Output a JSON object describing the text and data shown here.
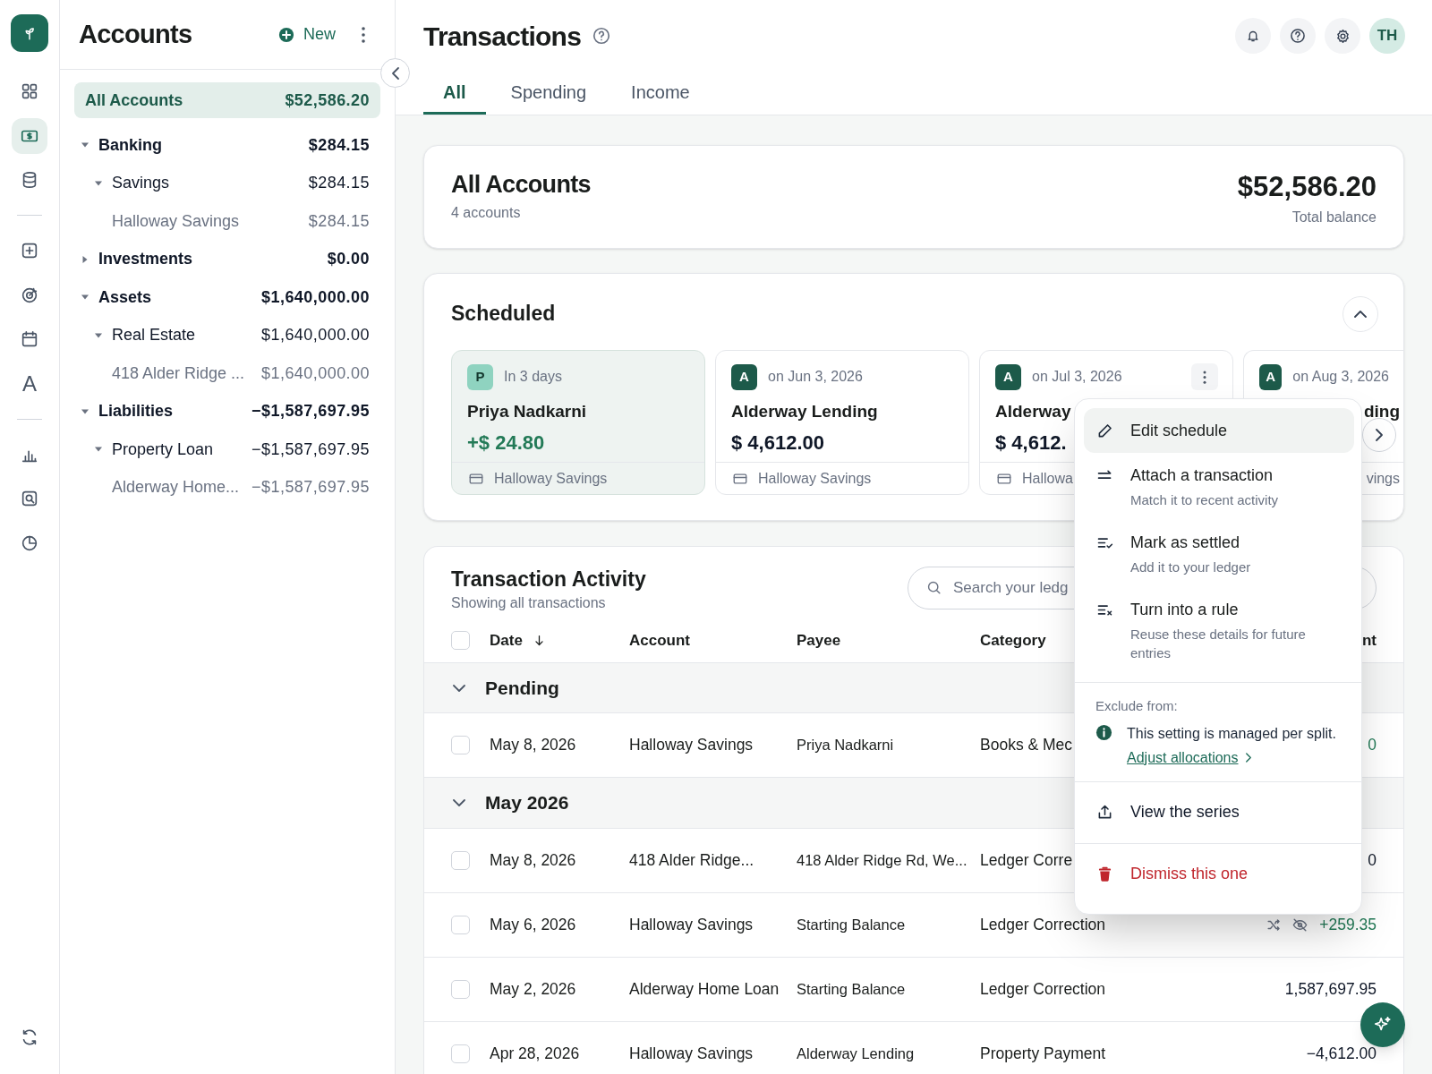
{
  "rail": {
    "groups": [
      {
        "items": [
          {
            "kind": "grid",
            "selected": false
          },
          {
            "kind": "money",
            "selected": true
          },
          {
            "kind": "database",
            "selected": false
          }
        ]
      },
      {
        "items": [
          {
            "kind": "add",
            "selected": false
          },
          {
            "kind": "target",
            "selected": false
          },
          {
            "kind": "calendar",
            "selected": false
          },
          {
            "kind": "letter",
            "label": "A",
            "selected": false
          }
        ]
      },
      {
        "items": [
          {
            "kind": "chart",
            "selected": false
          },
          {
            "kind": "report",
            "selected": false
          },
          {
            "kind": "pie",
            "selected": false
          }
        ]
      }
    ],
    "footer": [
      {
        "kind": "sync",
        "selected": false
      }
    ]
  },
  "accounts": {
    "title": "Accounts",
    "new_button": "New",
    "all_accounts": {
      "label": "All Accounts",
      "amount": "$52,586.20",
      "selected": true
    },
    "tree": [
      {
        "label": "Banking",
        "amount": "$284.15",
        "expanded": true,
        "children": [
          {
            "label": "Savings",
            "amount": "$284.15",
            "expanded": true,
            "children": [
              {
                "label": "Halloway Savings",
                "amount": "$284.15"
              }
            ]
          }
        ]
      },
      {
        "label": "Investments",
        "amount": "$0.00",
        "expanded": false
      },
      {
        "label": "Assets",
        "amount": "$1,640,000.00",
        "expanded": true,
        "children": [
          {
            "label": "Real Estate",
            "amount": "$1,640,000.00",
            "expanded": true,
            "children": [
              {
                "label": "418 Alder Ridge ...",
                "amount": "$1,640,000.00"
              }
            ]
          }
        ]
      },
      {
        "label": "Liabilities",
        "amount": "−$1,587,697.95",
        "expanded": true,
        "children": [
          {
            "label": "Property Loan",
            "amount": "−$1,587,697.95",
            "expanded": true,
            "children": [
              {
                "label": "Alderway Home...",
                "amount": "−$1,587,697.95"
              }
            ]
          }
        ]
      }
    ]
  },
  "header": {
    "title": "Transactions",
    "user_initials": "TH"
  },
  "tabs": [
    {
      "label": "All",
      "selected": true
    },
    {
      "label": "Spending",
      "selected": false
    },
    {
      "label": "Income",
      "selected": false
    }
  ],
  "summary": {
    "title": "All Accounts",
    "subtitle": "4 accounts",
    "amount": "$52,586.20",
    "amount_label": "Total balance"
  },
  "scheduled": {
    "title": "Scheduled",
    "expanded": true,
    "cards": [
      {
        "avatar": "P",
        "color": "#8fd3c0",
        "when": "In 3 days",
        "payee": "Priya Nadkarni",
        "amount": "+$ 24.80",
        "positive": true,
        "account": "Halloway Savings",
        "selected": true,
        "menu_open": false,
        "covered": false
      },
      {
        "avatar": "A",
        "color": "#1d5a4a",
        "when": "on Jun 3, 2026",
        "payee": "Alderway Lending",
        "amount": "$ 4,612.00",
        "positive": false,
        "account": "Halloway Savings",
        "selected": false,
        "menu_open": false,
        "covered": false
      },
      {
        "avatar": "A",
        "color": "#1d5a4a",
        "when": "on Jul 3, 2026",
        "payee": "Alderway",
        "amount": "$ 4,612.",
        "positive": false,
        "account": "Hallowa",
        "selected": false,
        "menu_open": true,
        "covered": false
      },
      {
        "avatar": "A",
        "color": "#1d5a4a",
        "when": "on Aug 3, 2026",
        "payee": "ding",
        "account": "vings",
        "selected": false,
        "menu_open": false,
        "covered": true
      }
    ]
  },
  "activity": {
    "title": "Transaction Activity",
    "subtitle": "Showing all transactions",
    "search": {
      "placeholder": "Search your ledg"
    },
    "all_checked": false,
    "columns": [
      {
        "label": "Date",
        "sorted": true
      },
      {
        "label": "Account",
        "sorted": false
      },
      {
        "label": "Payee",
        "sorted": false
      },
      {
        "label": "Category",
        "sorted": false
      },
      {
        "label": "nt",
        "sorted": false
      }
    ],
    "groups": [
      {
        "label": "Pending",
        "expanded": true,
        "rows": [
          {
            "checked": false,
            "date": "May 8, 2026",
            "account": "Halloway Savings",
            "payee": "Priya Nadkarni",
            "category": "Books & Mec",
            "amount": "0",
            "positive": true,
            "split": false,
            "excluded": false
          }
        ]
      },
      {
        "label": "May 2026",
        "expanded": true,
        "rows": [
          {
            "checked": false,
            "date": "May 8, 2026",
            "account": "418 Alder Ridge...",
            "payee": "418 Alder Ridge Rd, We...",
            "category": "Ledger Corre",
            "amount": "0",
            "positive": false,
            "split": false,
            "excluded": false
          },
          {
            "checked": false,
            "date": "May 6, 2026",
            "account": "Halloway Savings",
            "payee": "Starting Balance",
            "category": "Ledger Correction",
            "amount": "+259.35",
            "positive": true,
            "split": true,
            "excluded": true
          },
          {
            "checked": false,
            "date": "May 2, 2026",
            "account": "Alderway Home Loan",
            "payee": "Starting Balance",
            "category": "Ledger Correction",
            "amount": "1,587,697.95",
            "positive": false,
            "split": false,
            "excluded": false
          },
          {
            "checked": false,
            "date": "Apr 28, 2026",
            "account": "Halloway Savings",
            "payee": "Alderway Lending",
            "category": "Property Payment",
            "amount": "−4,612.00",
            "positive": false,
            "split": false,
            "excluded": false
          }
        ]
      }
    ]
  },
  "menu": {
    "items": [
      {
        "kind": "edit",
        "label": "Edit schedule",
        "selected": true
      },
      {
        "kind": "attach",
        "label": "Attach a transaction",
        "hint": "Match it to recent activity",
        "selected": false
      },
      {
        "kind": "settle",
        "label": "Mark as settled",
        "hint": "Add it to your ledger",
        "selected": false
      },
      {
        "kind": "rule",
        "label": "Turn into a rule",
        "hint": "Reuse these details for future entries",
        "selected": false
      }
    ],
    "exclude": {
      "label": "Exclude from:",
      "note": "This setting is managed per split.",
      "link": "Adjust allocations"
    },
    "actions": [
      {
        "kind": "view",
        "label": "View the series"
      },
      {
        "kind": "dismiss",
        "label": "Dismiss this one"
      }
    ]
  }
}
